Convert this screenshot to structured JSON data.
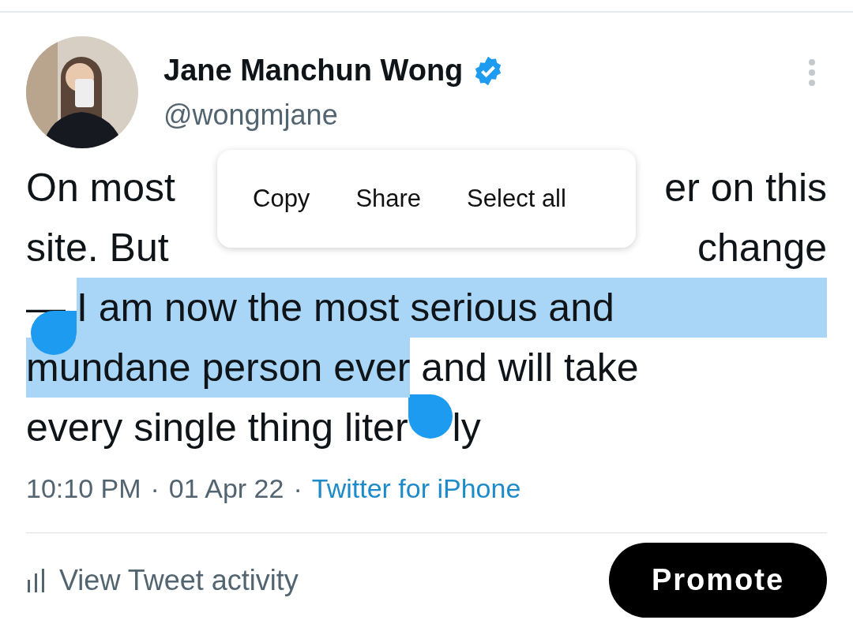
{
  "author": {
    "name": "Jane Manchun Wong",
    "verified": true,
    "handle": "@wongmjane"
  },
  "tweet_lines": [
    {
      "kind": "split",
      "segments": [
        {
          "text": "On most",
          "selected": false
        },
        {
          "text": "er on this",
          "selected": false
        }
      ]
    },
    {
      "kind": "split",
      "segments": [
        {
          "text": "site. But",
          "selected": false
        },
        {
          "text": "change",
          "selected": false
        }
      ]
    },
    {
      "kind": "plain",
      "segments": [
        {
          "text": "— ",
          "selected": false
        },
        {
          "text": "I am now the most serious and",
          "selected": true
        }
      ]
    },
    {
      "kind": "plain",
      "segments": [
        {
          "text": "mundane person ever",
          "selected": true
        },
        {
          "text": " and will take",
          "selected": false
        }
      ]
    },
    {
      "kind": "covered",
      "segments": [
        {
          "text": "every single thing liter",
          "selected": false
        },
        {
          "text": "ly",
          "selected": false
        }
      ]
    }
  ],
  "context_menu": [
    "Copy",
    "Share",
    "Select all"
  ],
  "meta": {
    "time": "10:10 PM",
    "separator_1": "·",
    "date": "01 Apr 22",
    "separator_2": "·",
    "source": "Twitter for iPhone"
  },
  "activity_link": "View Tweet activity",
  "promote_button": "Promote"
}
